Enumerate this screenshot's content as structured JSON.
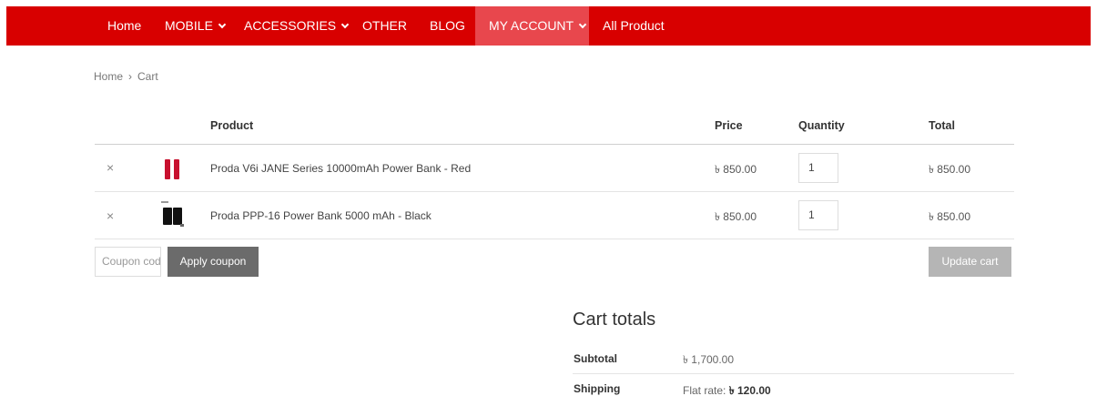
{
  "nav": {
    "items": [
      {
        "label": "Home",
        "dropdown": false
      },
      {
        "label": "MOBILE",
        "dropdown": true
      },
      {
        "label": "ACCESSORIES",
        "dropdown": true
      },
      {
        "label": "OTHER",
        "dropdown": false
      },
      {
        "label": "BLOG",
        "dropdown": false
      },
      {
        "label": "MY ACCOUNT",
        "dropdown": true,
        "active": true
      },
      {
        "label": "All Product",
        "dropdown": false
      }
    ],
    "bg_color": "#d80000",
    "active_color": "#e8474d"
  },
  "breadcrumb": {
    "home": "Home",
    "separator": "›",
    "current": "Cart"
  },
  "cart": {
    "headers": {
      "product": "Product",
      "price": "Price",
      "quantity": "Quantity",
      "total": "Total"
    },
    "rows": [
      {
        "remove": "×",
        "name": "Proda V6i JANE Series 10000mAh Power Bank - Red",
        "price": "৳ 850.00",
        "qty": "1",
        "total": "৳ 850.00",
        "thumb_color": "#c8102e"
      },
      {
        "remove": "×",
        "name": "Proda PPP-16 Power Bank 5000 mAh - Black",
        "price": "৳ 850.00",
        "qty": "1",
        "total": "৳ 850.00",
        "thumb_color": "#111111"
      }
    ],
    "coupon_placeholder": "Coupon code",
    "apply_label": "Apply coupon",
    "update_label": "Update cart"
  },
  "totals": {
    "title": "Cart totals",
    "subtotal_label": "Subtotal",
    "subtotal_value": "৳ 1,700.00",
    "shipping_label": "Shipping",
    "shipping_prefix": "Flat rate: ",
    "shipping_value": "৳ 120.00"
  }
}
